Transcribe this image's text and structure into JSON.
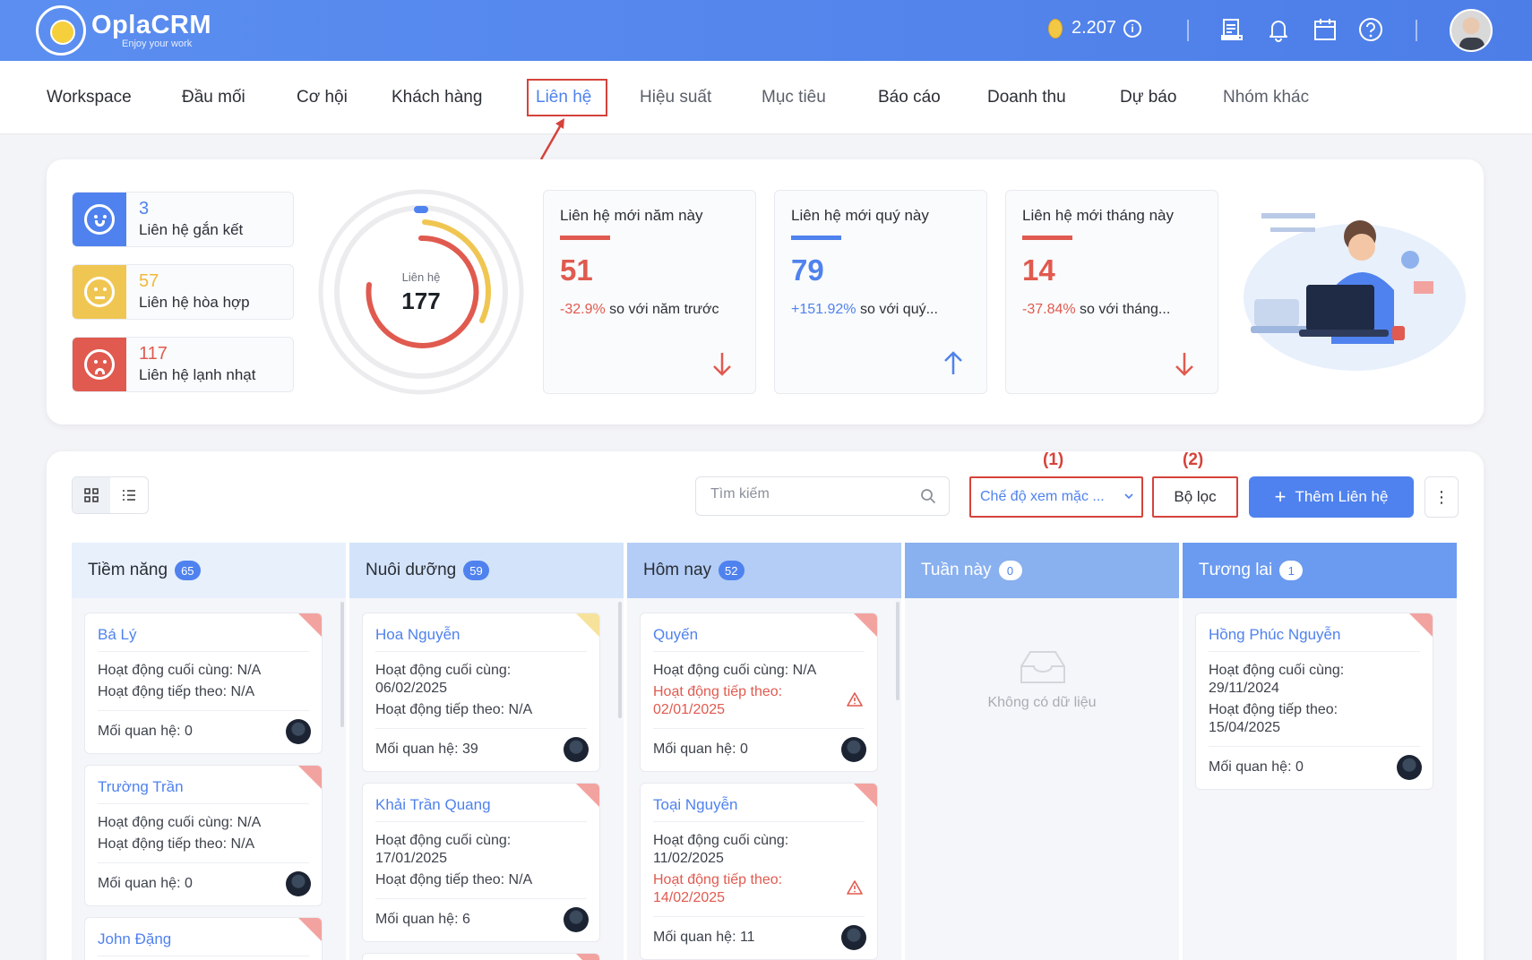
{
  "header": {
    "brand": "OplaCRM",
    "slogan": "Enjoy your work",
    "credits": "2.207",
    "info_symbol": "i"
  },
  "nav": {
    "items": [
      "Workspace",
      "Đầu mối",
      "Cơ hội",
      "Khách hàng",
      "Liên hệ",
      "Hiệu suất",
      "Mục tiêu",
      "Báo cáo",
      "Doanh thu",
      "Dự báo",
      "Nhóm khác"
    ],
    "active": "Liên hệ"
  },
  "summary": {
    "relations": [
      {
        "count": "3",
        "label": "Liên hệ gắn kết",
        "color": "#4f82ee"
      },
      {
        "count": "57",
        "label": "Liên hệ hòa hợp",
        "color": "#f0c652"
      },
      {
        "count": "117",
        "label": "Liên hệ lạnh nhạt",
        "color": "#e05a4f"
      }
    ],
    "donut": {
      "label": "Liên hệ",
      "total": "177"
    },
    "stats": [
      {
        "title": "Liên hệ mới năm này",
        "value": "51",
        "change": "-32.9%",
        "compare": "so với năm trước",
        "trend": "down",
        "color": "#e05a4f"
      },
      {
        "title": "Liên hệ mới quý này",
        "value": "79",
        "change": "+151.92%",
        "compare": "so với quý...",
        "trend": "up",
        "color": "#4f82ee"
      },
      {
        "title": "Liên hệ mới tháng này",
        "value": "14",
        "change": "-37.84%",
        "compare": "so với tháng...",
        "trend": "down",
        "color": "#e05a4f"
      }
    ]
  },
  "toolbar": {
    "search_placeholder": "Tìm kiếm",
    "view_mode": "Chế độ xem mặc ...",
    "filter": "Bộ lọc",
    "add": "Thêm Liên hệ",
    "marker1": "(1)",
    "marker2": "(2)",
    "more": "⋮"
  },
  "columns": [
    {
      "title": "Tiềm năng",
      "count": "65",
      "head_bg": "#e8f0fc",
      "badge_bg": "#4f82ee",
      "badge_fg": "#ffffff",
      "cards": [
        {
          "name": "Bá Lý",
          "last": "Hoạt động cuối cùng: N/A",
          "next": "Hoạt động tiếp theo: N/A",
          "rel": "Mối quan hệ: 0",
          "flag": "#f2a3a0"
        },
        {
          "name": "Trường Trần",
          "last": "Hoạt động cuối cùng: N/A",
          "next": "Hoạt động tiếp theo: N/A",
          "rel": "Mối quan hệ: 0",
          "flag": "#f2a3a0"
        },
        {
          "name": "John Đặng",
          "flag": "#f2a3a0"
        }
      ]
    },
    {
      "title": "Nuôi dưỡng",
      "count": "59",
      "head_bg": "#d3e3fa",
      "badge_bg": "#4f82ee",
      "badge_fg": "#ffffff",
      "cards": [
        {
          "name": "Hoa Nguyễn",
          "last_label": "Hoạt động cuối cùng:",
          "last_date": "06/02/2025",
          "next": "Hoạt động tiếp theo: N/A",
          "rel": "Mối quan hệ: 39",
          "flag": "#f7e29c"
        },
        {
          "name": "Khải Trần Quang",
          "last_label": "Hoạt động cuối cùng:",
          "last_date": "17/01/2025",
          "next": "Hoạt động tiếp theo: N/A",
          "rel": "Mối quan hệ: 6",
          "flag": "#f2a3a0"
        }
      ]
    },
    {
      "title": "Hôm nay",
      "count": "52",
      "head_bg": "#b3cdf6",
      "badge_bg": "#4f82ee",
      "badge_fg": "#ffffff",
      "cards": [
        {
          "name": "Quyến",
          "last": "Hoạt động cuối cùng: N/A",
          "next_label": "Hoạt động tiếp theo:",
          "next_date": "02/01/2025",
          "rel": "Mối quan hệ: 0",
          "flag": "#f2a3a0"
        },
        {
          "name": "Toại Nguyễn",
          "last_label": "Hoạt động cuối cùng:",
          "last_date": "11/02/2025",
          "next_label": "Hoạt động tiếp theo:",
          "next_date": "14/02/2025",
          "rel": "Mối quan hệ: 11",
          "flag": "#f2a3a0"
        }
      ]
    },
    {
      "title": "Tuần này",
      "count": "0",
      "head_bg": "#89b0ef",
      "badge_bg": "#ffffff",
      "badge_fg": "#4f82ee",
      "empty": "Không có dữ liệu"
    },
    {
      "title": "Tương lai",
      "count": "1",
      "head_bg": "#6b9bf0",
      "badge_bg": "#ffffff",
      "badge_fg": "#4f82ee",
      "cards": [
        {
          "name": "Hồng Phúc Nguyễn",
          "last_label": "Hoạt động cuối cùng:",
          "last_date": "29/11/2024",
          "next_label": "Hoạt động tiếp theo:",
          "next_date": "15/04/2025",
          "rel": "Mối quan hệ: 0",
          "flag": "#f2a3a0"
        }
      ]
    }
  ]
}
